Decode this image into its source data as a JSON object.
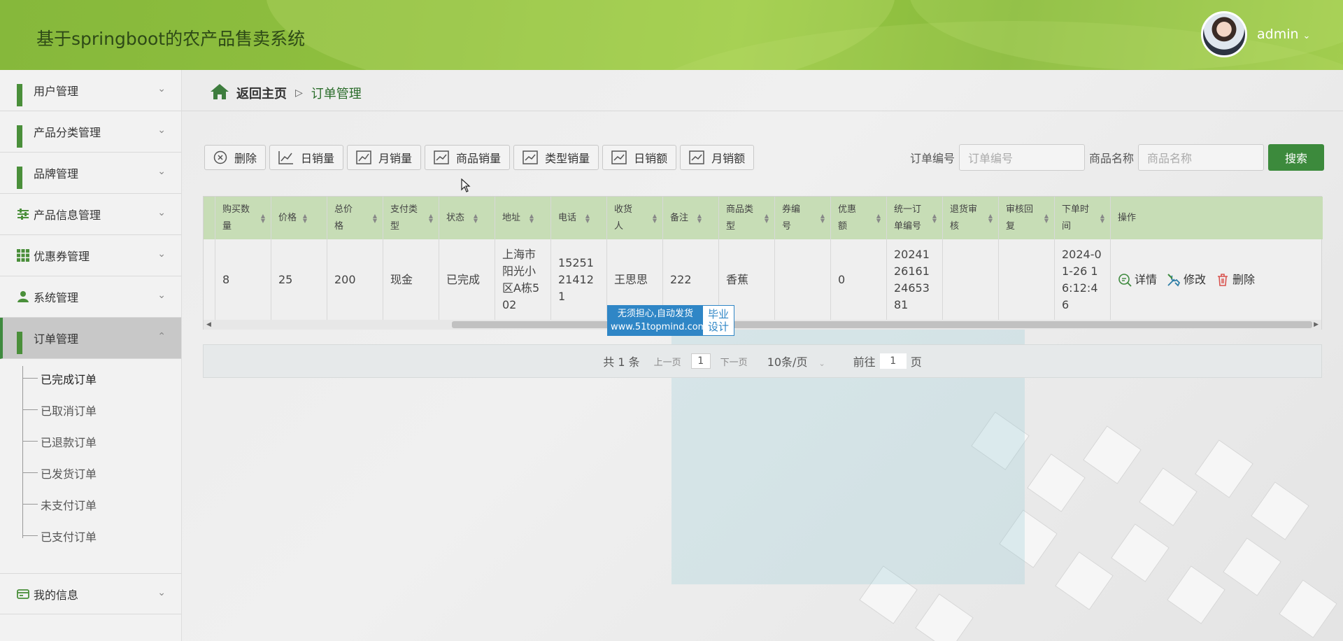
{
  "header": {
    "title": "基于springboot的农产品售卖系统",
    "user": "admin"
  },
  "sidebar": {
    "items": [
      {
        "label": "用户管理",
        "icon": "grid-icon"
      },
      {
        "label": "产品分类管理",
        "icon": "grid-icon"
      },
      {
        "label": "品牌管理",
        "icon": "grid-icon"
      },
      {
        "label": "产品信息管理",
        "icon": "sliders-icon"
      },
      {
        "label": "优惠券管理",
        "icon": "grid9-icon"
      },
      {
        "label": "系统管理",
        "icon": "user-icon"
      },
      {
        "label": "订单管理",
        "icon": "grid-icon"
      },
      {
        "label": "我的信息",
        "icon": "card-icon"
      }
    ],
    "order_sub": [
      "已完成订单",
      "已取消订单",
      "已退款订单",
      "已发货订单",
      "未支付订单",
      "已支付订单"
    ]
  },
  "breadcrumb": {
    "home": "返回主页",
    "current": "订单管理"
  },
  "toolbar": {
    "buttons": [
      "删除",
      "日销量",
      "月销量",
      "商品销量",
      "类型销量",
      "日销额",
      "月销额"
    ]
  },
  "search": {
    "label1": "订单编号",
    "placeholder1": "订单编号",
    "label2": "商品名称",
    "placeholder2": "商品名称",
    "button": "搜索"
  },
  "table": {
    "headers": [
      "购买数量",
      "价格",
      "总价格",
      "支付类型",
      "状态",
      "地址",
      "电话",
      "收货人",
      "备注",
      "商品类型",
      "券编号",
      "优惠额",
      "统一订单编号",
      "退货审核",
      "审核回复",
      "下单时间",
      "操作"
    ],
    "rows": [
      [
        "8",
        "25",
        "200",
        "现金",
        "已完成",
        "上海市阳光小区A栋502",
        "15251214121",
        "王思思",
        "222",
        "香蕉",
        "",
        "0",
        "20241261612465381",
        "",
        "",
        "2024-01-26 16:12:46"
      ]
    ],
    "actions": [
      "详情",
      "修改",
      "删除"
    ]
  },
  "pager": {
    "total": "共 1 条",
    "prev": "上一页",
    "page": "1",
    "next": "下一页",
    "size": "10条/页",
    "goto": "前往",
    "goto_page": "1",
    "page_suffix": "页"
  },
  "watermark": {
    "line1": "无须担心,自动发货",
    "line2": "www.51topmind.com",
    "right": "毕业设计"
  }
}
